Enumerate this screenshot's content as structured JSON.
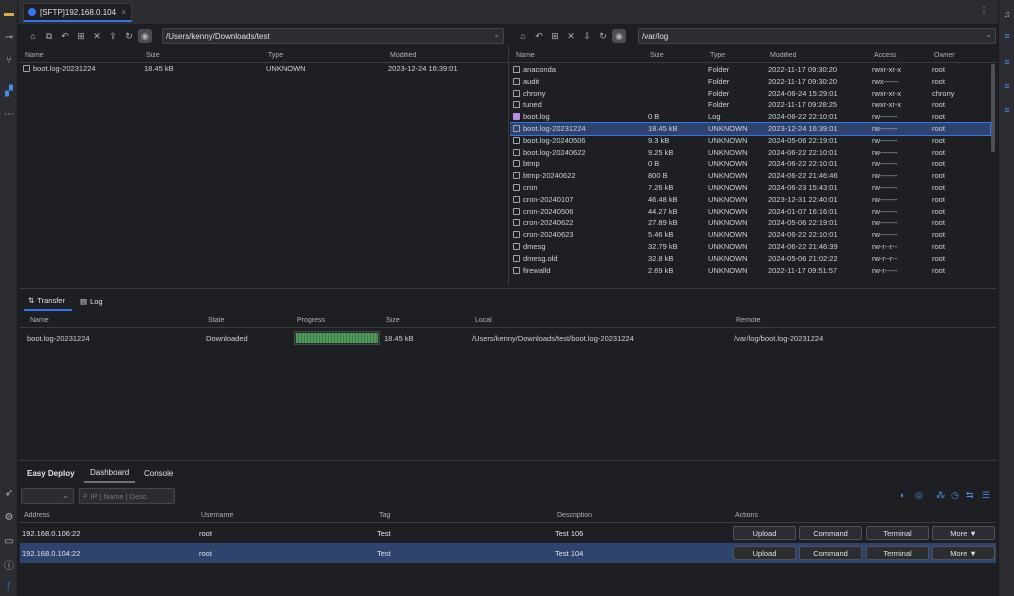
{
  "tab": {
    "title": "[SFTP]192.168.0.104",
    "close": "×"
  },
  "local": {
    "path": "/Users/kenny/Downloads/test",
    "columns": [
      "Name",
      "Size",
      "Type",
      "Modified"
    ],
    "rows": [
      {
        "name": "boot.log-20231224",
        "size": "18.45 kB",
        "type": "UNKNOWN",
        "modified": "2023-12-24 16:39:01"
      }
    ]
  },
  "remote": {
    "path": "/var/log",
    "columns": [
      "Name",
      "Size",
      "Type",
      "Modified",
      "Access",
      "Owner"
    ],
    "rows": [
      {
        "name": "anaconda",
        "size": "",
        "type": "Folder",
        "modified": "2022-11-17 09:30:20",
        "access": "rwxr-xr-x",
        "owner": "root",
        "kind": "folder"
      },
      {
        "name": "audit",
        "size": "",
        "type": "Folder",
        "modified": "2022-11-17 09:30:20",
        "access": "rwx------",
        "owner": "root",
        "kind": "folder"
      },
      {
        "name": "chrony",
        "size": "",
        "type": "Folder",
        "modified": "2024-06-24 15:29:01",
        "access": "rwxr-xr-x",
        "owner": "chrony",
        "kind": "folder"
      },
      {
        "name": "tuned",
        "size": "",
        "type": "Folder",
        "modified": "2022-11-17 09:28:25",
        "access": "rwxr-xr-x",
        "owner": "root",
        "kind": "folder"
      },
      {
        "name": "boot.log",
        "size": "0 B",
        "type": "Log",
        "modified": "2024-06-22 22:10:01",
        "access": "rw-------",
        "owner": "root",
        "kind": "log"
      },
      {
        "name": "boot.log-20231224",
        "size": "18.45 kB",
        "type": "UNKNOWN",
        "modified": "2023-12-24 16:39:01",
        "access": "rw-------",
        "owner": "root",
        "kind": "file",
        "selected": true
      },
      {
        "name": "boot.log-20240506",
        "size": "9.3 kB",
        "type": "UNKNOWN",
        "modified": "2024-05-06 22:19:01",
        "access": "rw-------",
        "owner": "root",
        "kind": "file"
      },
      {
        "name": "boot.log-20240622",
        "size": "9.25 kB",
        "type": "UNKNOWN",
        "modified": "2024-06-22 22:10:01",
        "access": "rw-------",
        "owner": "root",
        "kind": "file"
      },
      {
        "name": "btmp",
        "size": "0 B",
        "type": "UNKNOWN",
        "modified": "2024-06-22 22:10:01",
        "access": "rw-------",
        "owner": "root",
        "kind": "file"
      },
      {
        "name": "btmp-20240622",
        "size": "800 B",
        "type": "UNKNOWN",
        "modified": "2024-06-22 21:46:46",
        "access": "rw-------",
        "owner": "root",
        "kind": "file"
      },
      {
        "name": "cron",
        "size": "7.26 kB",
        "type": "UNKNOWN",
        "modified": "2024-06-23 15:43:01",
        "access": "rw-------",
        "owner": "root",
        "kind": "file"
      },
      {
        "name": "cron-20240107",
        "size": "46.48 kB",
        "type": "UNKNOWN",
        "modified": "2023-12-31 22:40:01",
        "access": "rw-------",
        "owner": "root",
        "kind": "file"
      },
      {
        "name": "cron-20240506",
        "size": "44.27 kB",
        "type": "UNKNOWN",
        "modified": "2024-01-07 16:16:01",
        "access": "rw-------",
        "owner": "root",
        "kind": "file"
      },
      {
        "name": "cron-20240622",
        "size": "27.89 kB",
        "type": "UNKNOWN",
        "modified": "2024-05-06 22:19:01",
        "access": "rw-------",
        "owner": "root",
        "kind": "file"
      },
      {
        "name": "cron-20240623",
        "size": "5.46 kB",
        "type": "UNKNOWN",
        "modified": "2024-06-22 22:10:01",
        "access": "rw-------",
        "owner": "root",
        "kind": "file"
      },
      {
        "name": "dmesg",
        "size": "32.79 kB",
        "type": "UNKNOWN",
        "modified": "2024-06-22 21:46:39",
        "access": "rw-r--r--",
        "owner": "root",
        "kind": "file"
      },
      {
        "name": "dmesg.old",
        "size": "32.8 kB",
        "type": "UNKNOWN",
        "modified": "2024-05-06 21:02:22",
        "access": "rw-r--r--",
        "owner": "root",
        "kind": "file"
      },
      {
        "name": "firewalld",
        "size": "2.69 kB",
        "type": "UNKNOWN",
        "modified": "2022-11-17 09:51:57",
        "access": "rw-r-----",
        "owner": "root",
        "kind": "file"
      }
    ]
  },
  "transfer": {
    "tabs": [
      "Transfer",
      "Log"
    ],
    "columns": [
      "Name",
      "State",
      "Progress",
      "Size",
      "Local",
      "Remote"
    ],
    "rows": [
      {
        "name": "boot.log-20231224",
        "state": "Downloaded",
        "progress": 1.0,
        "size": "18.45 kB",
        "local": "/Users/kenny/Downloads/test/boot.log-20231224",
        "remote": "/var/log/boot.log-20231224"
      }
    ]
  },
  "deploy": {
    "tabs": [
      "Easy Deploy",
      "Dashboard",
      "Console"
    ],
    "search_placeholder": "IP | Name | Desc",
    "columns": [
      "Address",
      "Username",
      "Tag",
      "Description",
      "Actions"
    ],
    "rows": [
      {
        "address": "192.168.0.106:22",
        "username": "root",
        "tag": "Test",
        "description": "Test 106",
        "selected": false
      },
      {
        "address": "192.168.0.104:22",
        "username": "root",
        "tag": "Test",
        "description": "Test 104",
        "selected": true
      }
    ],
    "actions": [
      "Upload",
      "Command",
      "Terminal",
      "More ▼"
    ]
  },
  "colors": {
    "accent": "#3574f0",
    "selection": "#2e436e",
    "progress": "#4e9a5b"
  }
}
